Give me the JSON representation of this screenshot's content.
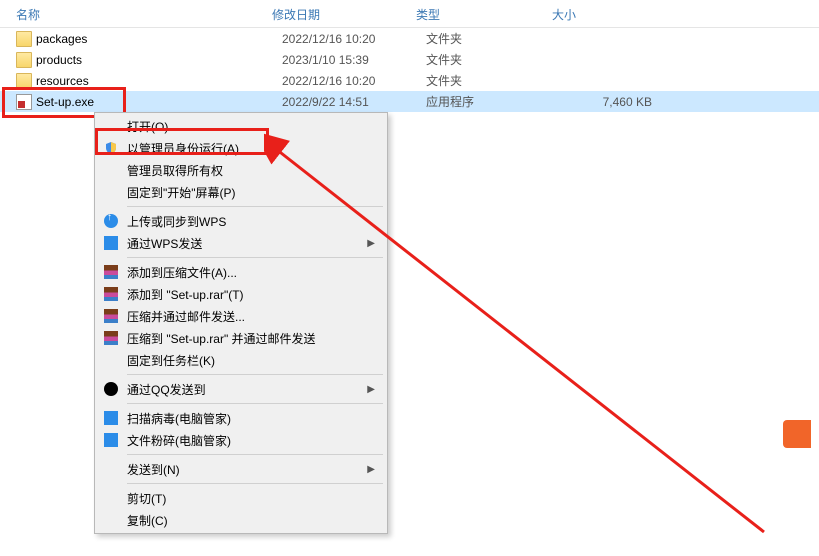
{
  "header": {
    "name": "名称",
    "date": "修改日期",
    "type": "类型",
    "size": "大小"
  },
  "rows": [
    {
      "icon": "folder",
      "name": "packages",
      "date": "2022/12/16 10:20",
      "type": "文件夹",
      "size": ""
    },
    {
      "icon": "folder",
      "name": "products",
      "date": "2023/1/10 15:39",
      "type": "文件夹",
      "size": ""
    },
    {
      "icon": "folder",
      "name": "resources",
      "date": "2022/12/16 10:20",
      "type": "文件夹",
      "size": ""
    },
    {
      "icon": "exe",
      "name": "Set-up.exe",
      "date": "2022/9/22 14:51",
      "type": "应用程序",
      "size": "7,460 KB",
      "selected": true
    }
  ],
  "ctx": {
    "open": "打开(O)",
    "run_admin": "以管理员身份运行(A)",
    "take_ownership": "管理员取得所有权",
    "pin_start": "固定到\"开始\"屏幕(P)",
    "wps_upload": "上传或同步到WPS",
    "wps_send": "通过WPS发送",
    "add_archive": "添加到压缩文件(A)...",
    "add_setup_rar": "添加到 \"Set-up.rar\"(T)",
    "compress_email": "压缩并通过邮件发送...",
    "compress_setup_email": "压缩到 \"Set-up.rar\" 并通过邮件发送",
    "pin_taskbar": "固定到任务栏(K)",
    "qq_send": "通过QQ发送到",
    "scan_virus": "扫描病毒(电脑管家)",
    "file_shred": "文件粉碎(电脑管家)",
    "send_to": "发送到(N)",
    "cut": "剪切(T)",
    "copy": "复制(C)"
  }
}
